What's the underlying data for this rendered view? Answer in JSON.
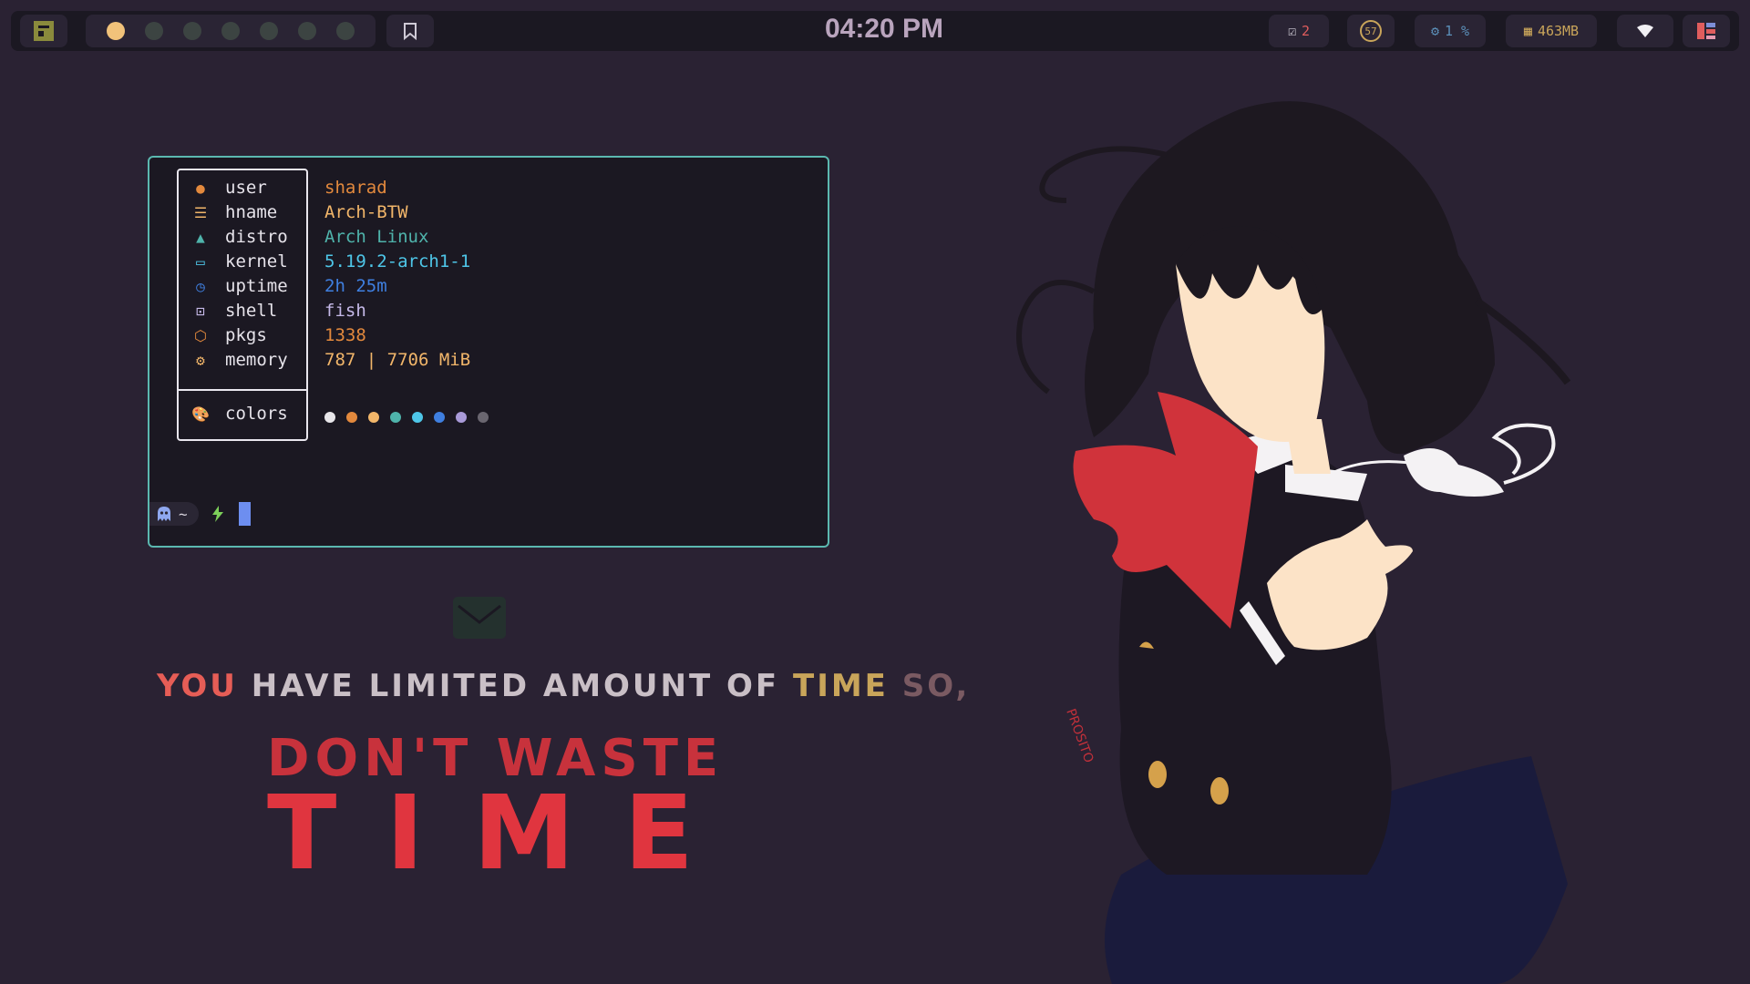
{
  "bar": {
    "clock": "04:20 PM",
    "workspaces": [
      "active",
      "inactive",
      "inactive",
      "inactive",
      "inactive",
      "inactive",
      "inactive"
    ],
    "todo_count": "2",
    "temperature": "57",
    "cpu": "1 %",
    "memory": "463MB",
    "icons": {
      "launcher": "launcher-icon",
      "bookmark": "bookmark-icon",
      "todo": "checkbox-icon",
      "temp": "thermometer-icon",
      "cpu": "cpu-icon",
      "mem": "memory-chip-icon",
      "wifi": "wifi-icon",
      "power": "powermenu-icon"
    }
  },
  "fetch": {
    "rows": [
      {
        "label": "user",
        "value": "sharad",
        "color": "#e3893d",
        "icon": "user-icon"
      },
      {
        "label": "hname",
        "value": "Arch-BTW",
        "color": "#f2b66a",
        "icon": "hostname-icon"
      },
      {
        "label": "distro",
        "value": "Arch Linux",
        "color": "#4fb3ab",
        "icon": "arch-icon"
      },
      {
        "label": "kernel",
        "value": "5.19.2-arch1-1",
        "color": "#4ec6e8",
        "icon": "laptop-icon"
      },
      {
        "label": "uptime",
        "value": "2h 25m",
        "color": "#3f7fe0",
        "icon": "clock-icon"
      },
      {
        "label": "shell",
        "value": "fish",
        "color": "#c5b9e8",
        "icon": "terminal-icon"
      },
      {
        "label": "pkgs",
        "value": "1338",
        "color": "#e3893d",
        "icon": "package-icon"
      },
      {
        "label": "memory",
        "value": "787 | 7706 MiB",
        "color": "#f2b66a",
        "icon": "chip-icon"
      }
    ],
    "colors_label": "colors",
    "palette": [
      "#e8e6ea",
      "#e3893d",
      "#f2b66a",
      "#4fb3ab",
      "#4ec6e8",
      "#3f7fe0",
      "#a99ad8",
      "#6a6670"
    ]
  },
  "prompt": {
    "dir": "~",
    "ghost_icon": "ghost-icon",
    "bolt_icon": "bolt-icon"
  },
  "quote": {
    "line1_you": "YOU",
    "line1_mid": "HAVE LIMITED AMOUNT OF",
    "line1_time": "TIME",
    "line1_so": "SO,",
    "line2": "DON'T WASTE",
    "line3": "TIME"
  },
  "art_signature": "PROSITO"
}
